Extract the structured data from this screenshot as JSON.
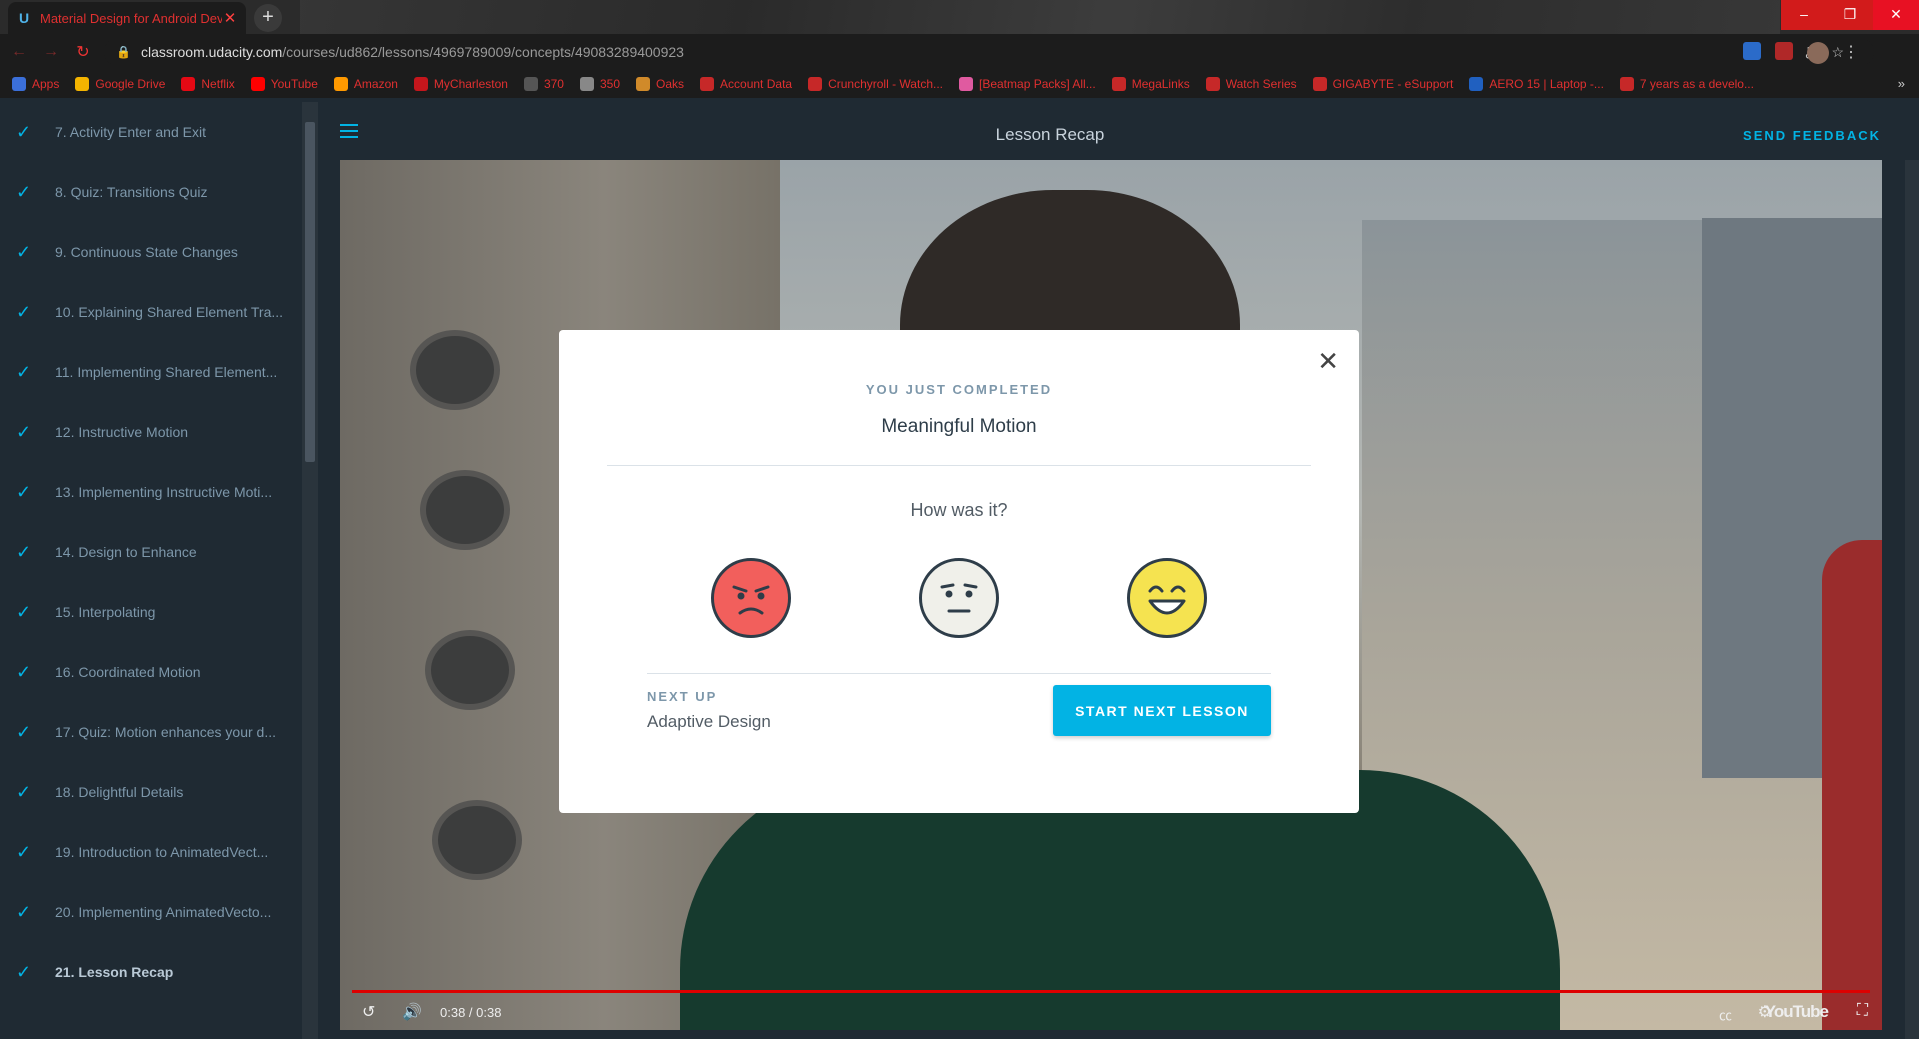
{
  "browser": {
    "tab_title": "Material Design for Android Dev",
    "url_host": "classroom.udacity.com",
    "url_path": "/courses/ud862/lessons/4969789009/concepts/49083289400923",
    "bookmarks": [
      "Apps",
      "Google Drive",
      "Netflix",
      "YouTube",
      "Amazon",
      "MyCharleston",
      "370",
      "350",
      "Oaks",
      "Account Data",
      "Crunchyroll - Watch...",
      "[Beatmap Packs] All...",
      "MegaLinks",
      "Watch Series",
      "GIGABYTE - eSupport",
      "AERO 15 | Laptop -...",
      "7 years as a develo..."
    ]
  },
  "sidebar": {
    "items": [
      {
        "label": "7. Activity Enter and Exit"
      },
      {
        "label": "8. Quiz: Transitions Quiz"
      },
      {
        "label": "9. Continuous State Changes"
      },
      {
        "label": "10. Explaining Shared Element Tra..."
      },
      {
        "label": "11. Implementing Shared Element..."
      },
      {
        "label": "12. Instructive Motion"
      },
      {
        "label": "13. Implementing Instructive Moti..."
      },
      {
        "label": "14. Design to Enhance"
      },
      {
        "label": "15. Interpolating"
      },
      {
        "label": "16. Coordinated Motion"
      },
      {
        "label": "17. Quiz: Motion enhances your d..."
      },
      {
        "label": "18. Delightful Details"
      },
      {
        "label": "19. Introduction to AnimatedVect..."
      },
      {
        "label": "20. Implementing AnimatedVecto..."
      },
      {
        "label": "21. Lesson Recap"
      }
    ]
  },
  "header": {
    "title": "Lesson Recap",
    "feedback": "SEND FEEDBACK"
  },
  "video": {
    "time": "0:38 / 0:38",
    "brand": "YouTube",
    "progress": 1.0
  },
  "modal": {
    "kicker": "YOU JUST COMPLETED",
    "lesson": "Meaningful Motion",
    "question": "How was it?",
    "next_label": "NEXT UP",
    "next_title": "Adaptive Design",
    "button": "START NEXT LESSON"
  },
  "colors": {
    "accent": "#02b3e4",
    "sad": "#f25f5c",
    "neutral": "#f0f0ea",
    "happy": "#f5e350"
  }
}
